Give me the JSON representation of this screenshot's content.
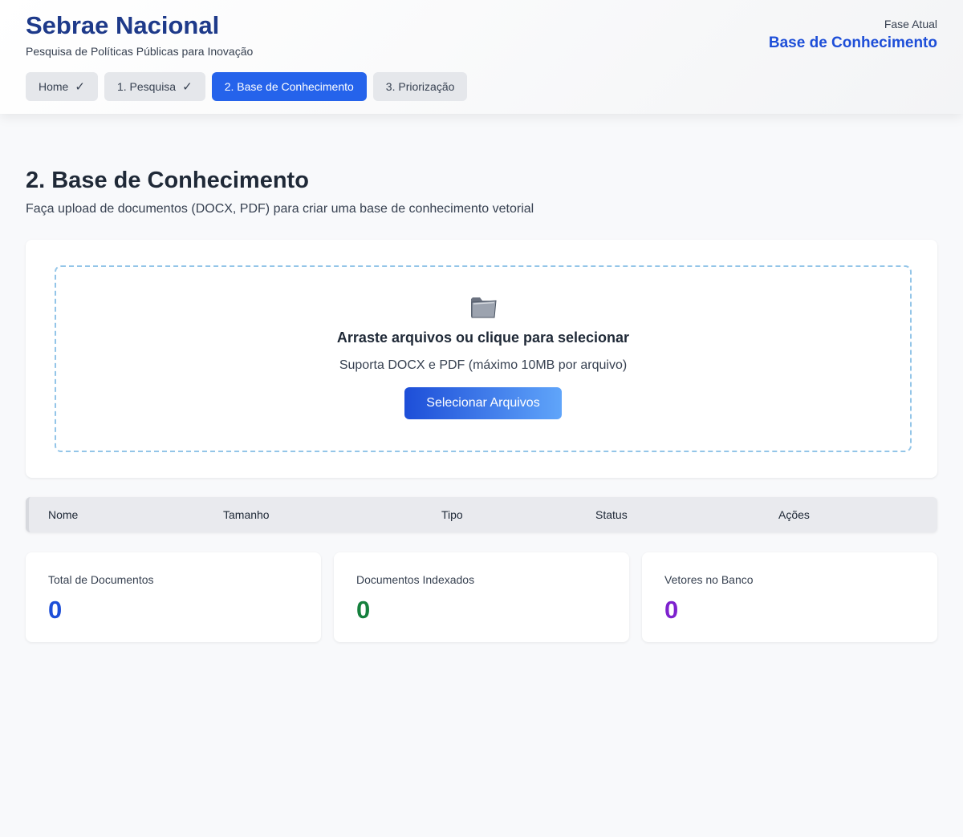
{
  "header": {
    "title": "Sebrae Nacional",
    "subtitle": "Pesquisa de Políticas Públicas para Inovação",
    "phase_label": "Fase Atual",
    "phase_value": "Base de Conhecimento"
  },
  "tabs": [
    {
      "label": "Home",
      "check": "✓",
      "active": false
    },
    {
      "label": "1. Pesquisa",
      "check": "✓",
      "active": false
    },
    {
      "label": "2. Base de Conhecimento",
      "check": "",
      "active": true
    },
    {
      "label": "3. Priorização",
      "check": "",
      "active": false
    }
  ],
  "page": {
    "title": "2. Base de Conhecimento",
    "description": "Faça upload de documentos (DOCX, PDF) para criar uma base de conhecimento vetorial"
  },
  "upload": {
    "icon": "folder-icon",
    "title": "Arraste arquivos ou clique para selecionar",
    "hint": "Suporta DOCX e PDF (máximo 10MB por arquivo)",
    "button_label": "Selecionar Arquivos"
  },
  "table": {
    "columns": [
      "Nome",
      "Tamanho",
      "Tipo",
      "Status",
      "Ações"
    ],
    "rows": []
  },
  "stats": [
    {
      "label": "Total de Documentos",
      "value": "0",
      "color": "#1d4ed8"
    },
    {
      "label": "Documentos Indexados",
      "value": "0",
      "color": "#15803d"
    },
    {
      "label": "Vetores no Banco",
      "value": "0",
      "color": "#7e22ce"
    }
  ]
}
